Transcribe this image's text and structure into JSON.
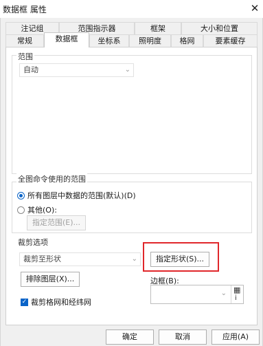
{
  "window": {
    "title": "数据框 属性",
    "close_glyph": "✕"
  },
  "tabs": {
    "row1": [
      "注记组",
      "范围指示器",
      "框架",
      "大小和位置"
    ],
    "row2": [
      "常规",
      "数据框",
      "坐标系",
      "照明度",
      "格网",
      "要素缓存"
    ],
    "active": "数据框"
  },
  "extent": {
    "group_label": "范围",
    "combo_value": "自动"
  },
  "full_extent": {
    "group_label": "全图命令使用的范围",
    "option_all_label": "所有图层中数据的范围(默认)(D)",
    "option_other_label": "其他(O):",
    "specify_extent_button": "指定范围(E)...",
    "selected": "all"
  },
  "clip": {
    "group_label": "裁剪选项",
    "combo_value": "裁剪至形状",
    "specify_shape_button": "指定形状(S)...",
    "exclude_layers_button": "排除图层(X)...",
    "border_label": "边框(B):",
    "clip_grids_label": "裁剪格网和经纬网",
    "clip_grids_checked": true
  },
  "footer": {
    "ok_label": "确定",
    "cancel_label": "取消",
    "apply_label": "应用(A)"
  },
  "icons": {
    "chevron": "⌄",
    "check": "✓",
    "grid_icon": "▦",
    "info_icon": "ⅰ"
  },
  "colors": {
    "accent": "#0a64c8",
    "highlight": "#e0262a"
  }
}
